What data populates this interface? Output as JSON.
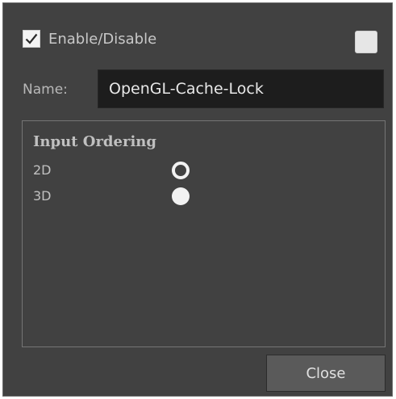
{
  "enable": {
    "label": "Enable/Disable",
    "checked": true,
    "icon": "checkmark-icon"
  },
  "color_swatch": {
    "color": "#e6e6e6"
  },
  "name_field": {
    "label": "Name:",
    "value": "OpenGL-Cache-Lock"
  },
  "input_ordering": {
    "title": "Input Ordering",
    "options": [
      {
        "label": "2D",
        "state": "ring"
      },
      {
        "label": "3D",
        "state": "filled"
      }
    ]
  },
  "footer": {
    "close_label": "Close"
  }
}
